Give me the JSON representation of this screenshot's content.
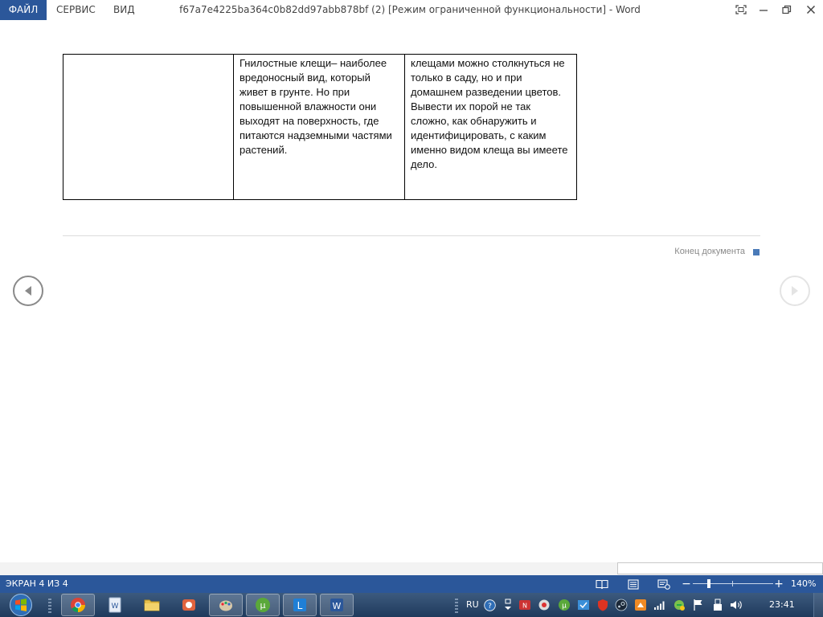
{
  "menu": {
    "file": "ФАЙЛ",
    "service": "СЕРВИС",
    "view": "ВИД"
  },
  "window": {
    "title": "f67a7e4225ba364c0b82dd97abb878bf (2) [Режим ограниченной функциональности] - Word"
  },
  "document": {
    "table": {
      "cells": [
        "",
        "Гнилостные клещи– наиболее вредоносный вид, который живет в грунте. Но при повышенной влажности они выходят на поверхность, где питаются надземными частями растений.",
        "клещами можно столкнуться не только в саду, но и при домашнем разведении цветов. Вывести их порой не так сложно, как обнаружить и идентифицировать, с каким именно видом клеща вы имеете дело."
      ]
    },
    "end_label": "Конец документа"
  },
  "statusbar": {
    "page_indicator": "ЭКРАН 4 ИЗ 4",
    "zoom_level": "140%",
    "zoom_minus": "−",
    "zoom_plus": "+"
  },
  "taskbar": {
    "language": "RU",
    "clock": "23:41"
  },
  "colors": {
    "accent": "#2b579a",
    "taskbar": "#2a476b"
  }
}
